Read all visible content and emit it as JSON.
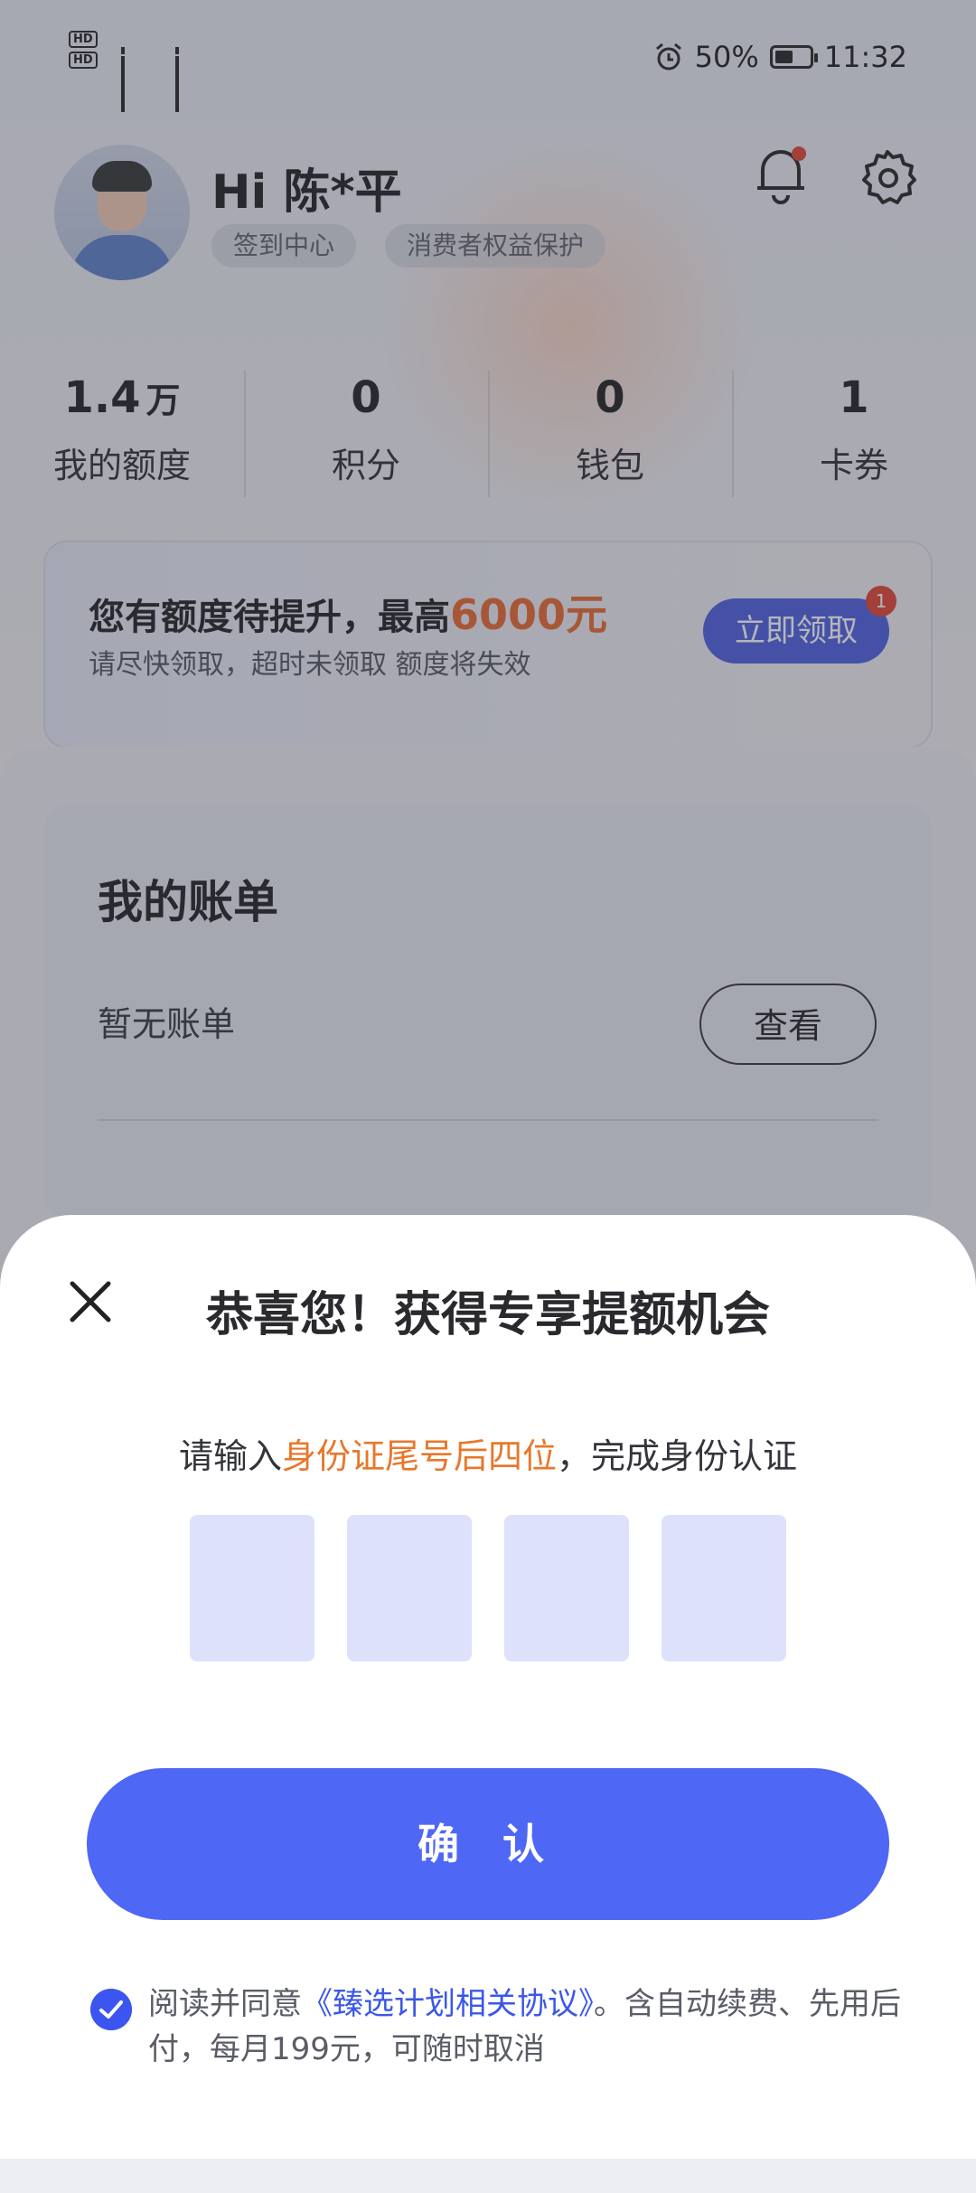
{
  "status_bar": {
    "left_label": "HD",
    "network_1": "4G",
    "network_2": "4G",
    "battery": "50%",
    "time": "11:32"
  },
  "profile": {
    "greeting": "Hi 陈*平",
    "tags": [
      "签到中心",
      "消费者权益保护"
    ]
  },
  "stats": [
    {
      "value": "1.4",
      "unit": "万",
      "label": "我的额度"
    },
    {
      "value": "0",
      "unit": "",
      "label": "积分"
    },
    {
      "value": "0",
      "unit": "",
      "label": "钱包"
    },
    {
      "value": "1",
      "unit": "",
      "label": "卡券"
    }
  ],
  "promo": {
    "title_prefix": "您有额度待提升，最高",
    "title_amount": "6000元",
    "subtitle": "请尽快领取，超时未领取 额度将失效",
    "button": "立即领取",
    "badge": "1"
  },
  "bill": {
    "title": "我的账单",
    "empty_text": "暂无账单",
    "view_button": "查看"
  },
  "modal": {
    "title": "恭喜您！获得专享提额机会",
    "instruction_prefix": "请输入",
    "instruction_highlight": "身份证尾号后四位",
    "instruction_suffix": "，完成身份认证",
    "confirm_button": "确 认",
    "agreement_prefix": "阅读并同意",
    "agreement_link": "《臻选计划相关协议》",
    "agreement_suffix": "。含自动续费、先用后付，每月199元，可随时取消",
    "agreement_checked": true
  },
  "colors": {
    "accent": "#4F67F5",
    "highlight": "#E8772B",
    "code_box": "#DDE1FB"
  }
}
